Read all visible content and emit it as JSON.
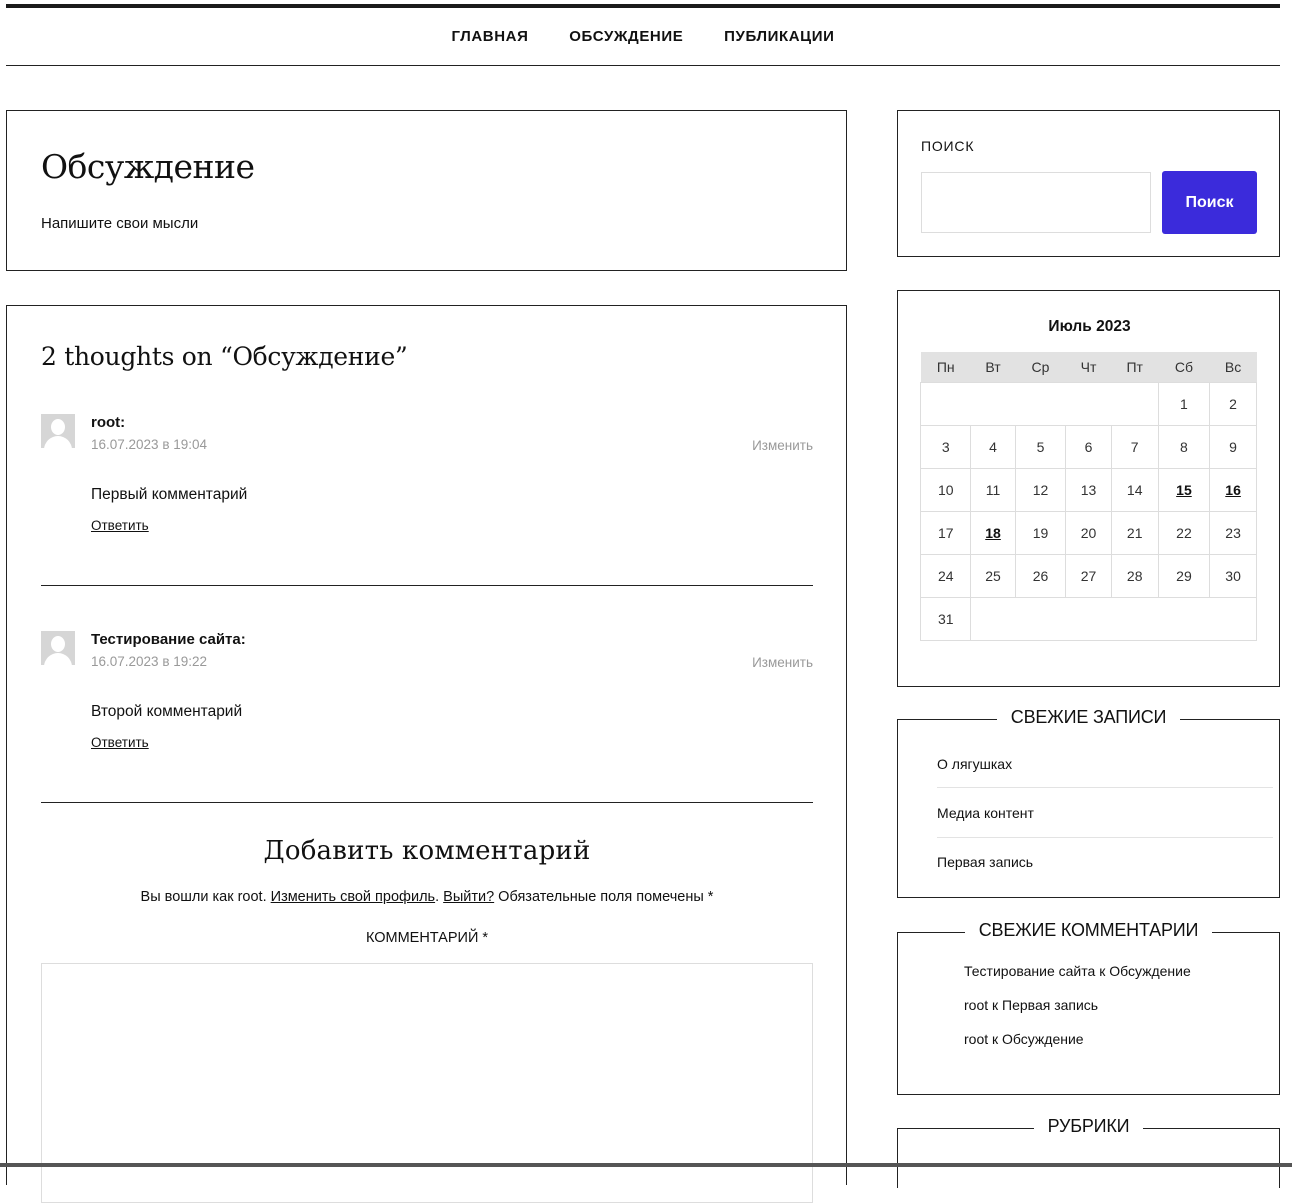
{
  "nav": {
    "items": [
      {
        "label": "ГЛАВНАЯ"
      },
      {
        "label": "ОБСУЖДЕНИЕ"
      },
      {
        "label": "ПУБЛИКАЦИИ"
      }
    ]
  },
  "page": {
    "title": "Обсуждение",
    "description": "Напишите свои мысли"
  },
  "comments": {
    "title": "2 thoughts on “Обсуждение”",
    "items": [
      {
        "author": "root:",
        "date": "16.07.2023 в 19:04",
        "edit": "Изменить",
        "text": "Первый комментарий",
        "reply": "Ответить"
      },
      {
        "author": "Тестирование сайта:",
        "date": "16.07.2023 в 19:22",
        "edit": "Изменить",
        "text": "Второй комментарий",
        "reply": "Ответить"
      }
    ]
  },
  "comment_form": {
    "title": "Добавить комментарий",
    "logged_prefix": "Вы вошли как root. ",
    "edit_profile": "Изменить свой профиль",
    "dot": ". ",
    "logout": "Выйти?",
    "required_note": " Обязательные поля помечены ",
    "required_star": "*",
    "comment_label": "КОММЕНТАРИЙ *"
  },
  "search": {
    "label": "ПОИСК",
    "button": "Поиск"
  },
  "calendar": {
    "caption": "Июль 2023",
    "weekdays": [
      "Пн",
      "Вт",
      "Ср",
      "Чт",
      "Пт",
      "Сб",
      "Вс"
    ],
    "row1": [
      "1",
      "2"
    ],
    "row2": [
      "3",
      "4",
      "5",
      "6",
      "7",
      "8",
      "9"
    ],
    "row3": [
      "10",
      "11",
      "12",
      "13",
      "14",
      "15",
      "16"
    ],
    "row4": [
      "17",
      "18",
      "19",
      "20",
      "21",
      "22",
      "23"
    ],
    "row5": [
      "24",
      "25",
      "26",
      "27",
      "28",
      "29",
      "30"
    ],
    "row6": [
      "31"
    ]
  },
  "recent_posts": {
    "title": "СВЕЖИЕ ЗАПИСИ",
    "items": [
      "О лягушках",
      "Медиа контент",
      "Первая запись"
    ]
  },
  "recent_comments": {
    "title": "СВЕЖИЕ КОММЕНТАРИИ",
    "items": [
      "Тестирование сайта к Обсуждение",
      "root к Первая запись",
      "root к Обсуждение"
    ]
  },
  "rubrics": {
    "title": "РУБРИКИ"
  }
}
